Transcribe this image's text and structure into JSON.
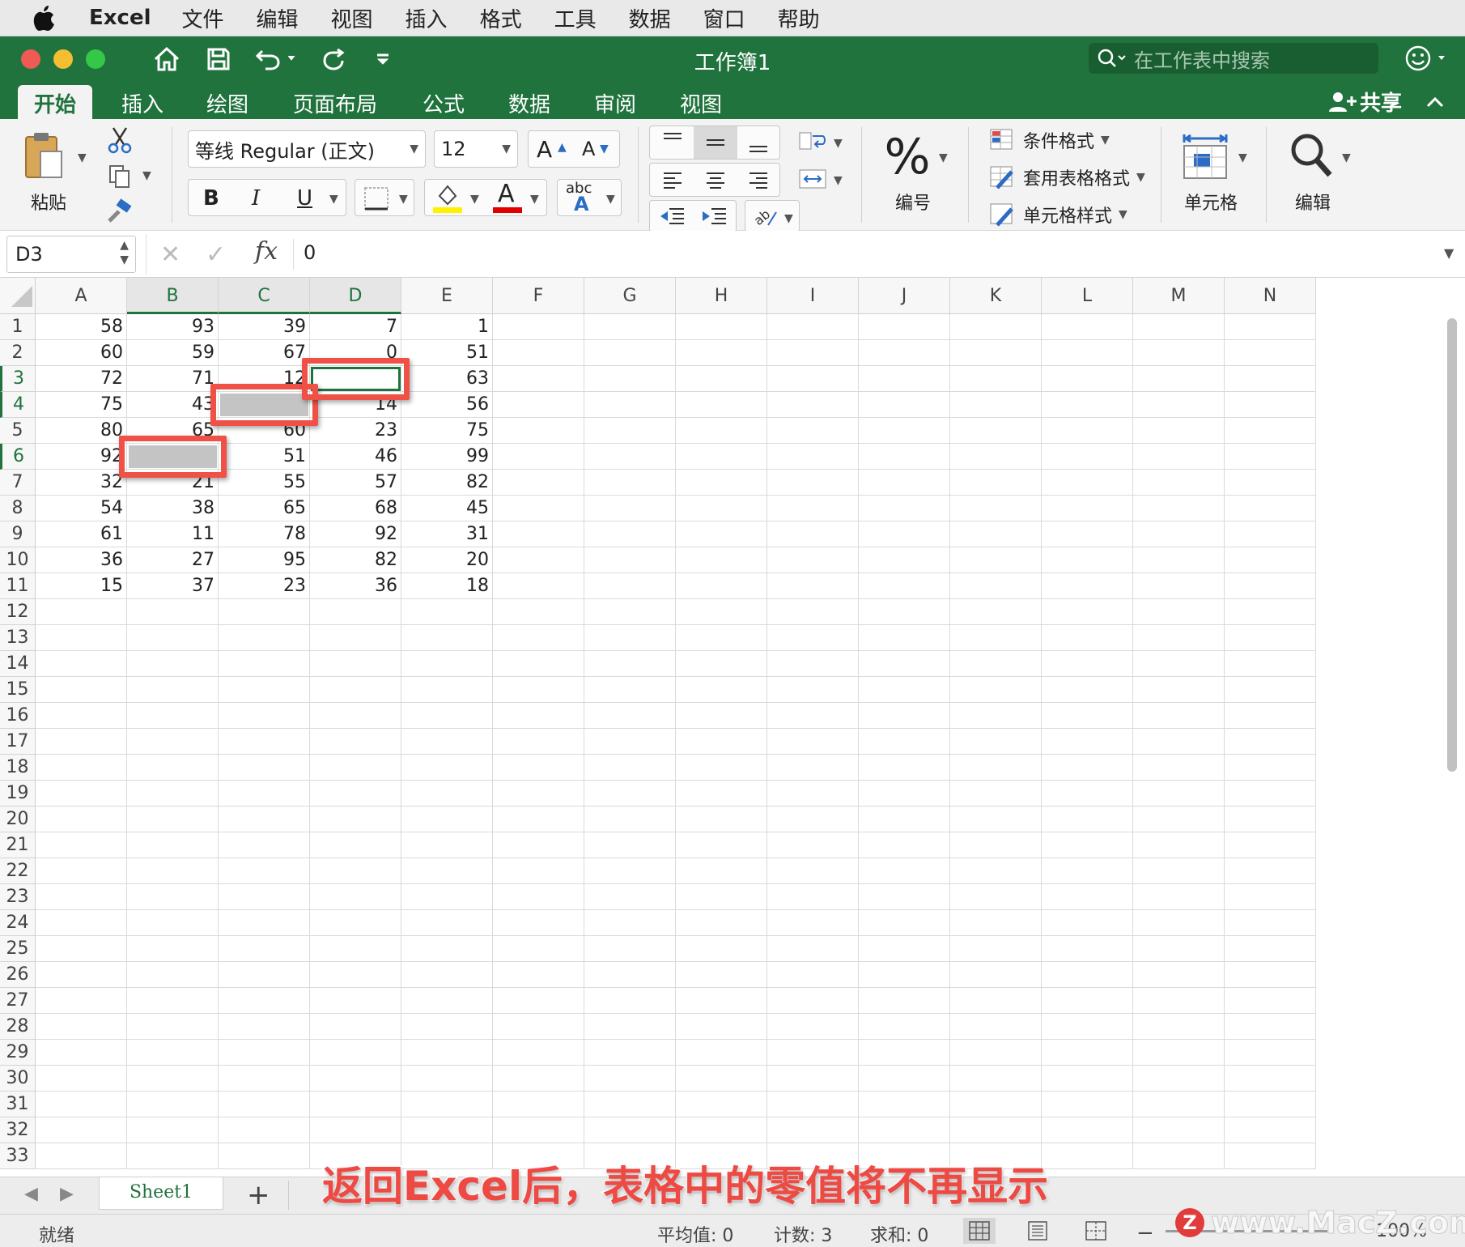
{
  "menubar": {
    "app_name": "Excel",
    "items": [
      "文件",
      "编辑",
      "视图",
      "插入",
      "格式",
      "工具",
      "数据",
      "窗口",
      "帮助"
    ]
  },
  "titlebar": {
    "title": "工作簿1",
    "search_placeholder": "在工作表中搜索"
  },
  "ribbon_tabs": {
    "tabs": [
      "开始",
      "插入",
      "绘图",
      "页面布局",
      "公式",
      "数据",
      "审阅",
      "视图"
    ],
    "active": "开始",
    "share_label": "共享"
  },
  "ribbon": {
    "paste_label": "粘贴",
    "font_name": "等线 Regular (正文)",
    "font_size": "12",
    "bold": "B",
    "italic": "I",
    "underline": "U",
    "grow_font": "A",
    "shrink_font": "A",
    "font_color_glyph": "A",
    "phonetic_top": "abc",
    "phonetic_bottom": "A",
    "number_symbol": "%",
    "number_label": "编号",
    "conditional_format": "条件格式",
    "format_as_table": "套用表格格式",
    "cell_styles": "单元格样式",
    "cells_label": "单元格",
    "edit_label": "编辑"
  },
  "formula_bar": {
    "name_box": "D3",
    "fx": "fx",
    "value": "0"
  },
  "grid": {
    "columns": [
      "A",
      "B",
      "C",
      "D",
      "E",
      "F",
      "G",
      "H",
      "I",
      "J",
      "K",
      "L",
      "M",
      "N"
    ],
    "selected_columns": [
      "B",
      "C",
      "D"
    ],
    "selected_rows": [
      3,
      4,
      6
    ],
    "row_count": 33,
    "rows": [
      [
        "58",
        "93",
        "39",
        "7",
        "1"
      ],
      [
        "60",
        "59",
        "67",
        "0",
        "51"
      ],
      [
        "72",
        "71",
        "12",
        "",
        "63"
      ],
      [
        "75",
        "43",
        "",
        "14",
        "56"
      ],
      [
        "80",
        "65",
        "60",
        "23",
        "75"
      ],
      [
        "92",
        "",
        "51",
        "46",
        "99"
      ],
      [
        "32",
        "21",
        "55",
        "57",
        "82"
      ],
      [
        "54",
        "38",
        "65",
        "68",
        "45"
      ],
      [
        "61",
        "11",
        "78",
        "92",
        "31"
      ],
      [
        "36",
        "27",
        "95",
        "82",
        "20"
      ],
      [
        "15",
        "37",
        "23",
        "36",
        "18"
      ]
    ]
  },
  "sheets": {
    "tabs": [
      "Sheet1"
    ],
    "add_label": "+"
  },
  "status": {
    "ready": "就绪",
    "average": "平均值: 0",
    "count": "计数: 3",
    "sum": "求和: 0",
    "zoom": "100%"
  },
  "overlay": {
    "caption": "返回Excel后，表格中的零值将不再显示",
    "watermark": "www.MacZ.com",
    "watermark_logo": "Z"
  },
  "colors": {
    "excel_green": "#20733d",
    "highlight_red": "#ef5147"
  }
}
